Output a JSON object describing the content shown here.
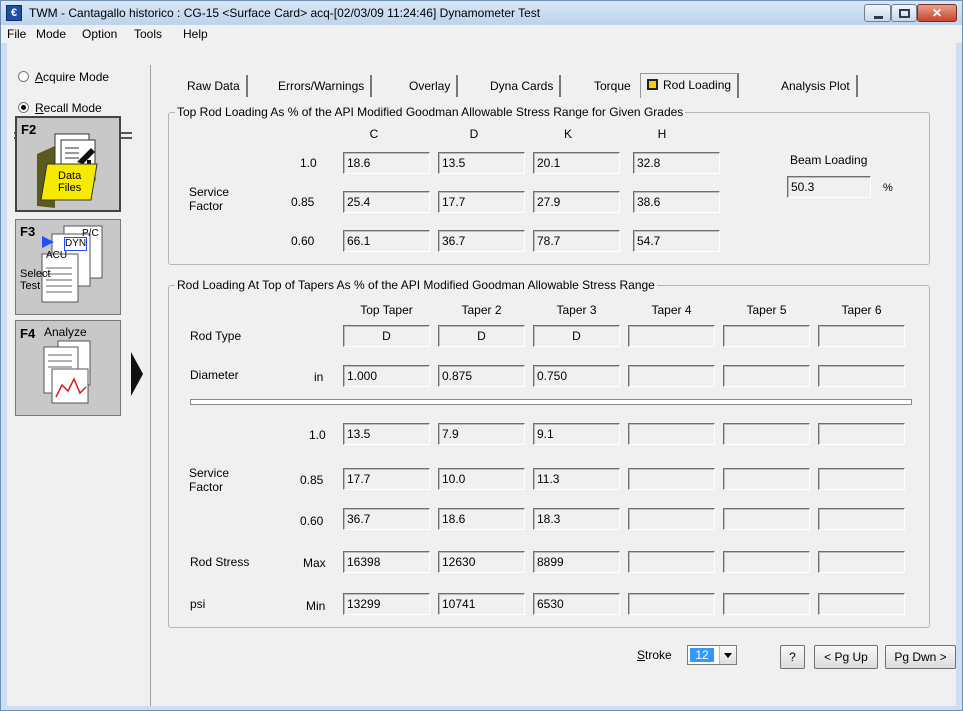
{
  "window": {
    "title": "TWM  -  Cantagallo historico : CG-15  <Surface Card>  acq-[02/03/09 11:24:46]  Dynamometer Test",
    "app_icon": "twm-app-icon",
    "close_glyph": "✕"
  },
  "menu": [
    "File",
    "Mode",
    "Option",
    "Tools",
    "Help"
  ],
  "sidebar": {
    "modes": [
      {
        "prefix": "",
        "accel": "A",
        "rest": "cquire Mode",
        "selected": false
      },
      {
        "prefix": "",
        "accel": "R",
        "rest": "ecall Mode",
        "selected": true
      }
    ],
    "buttons": [
      {
        "key": "F2",
        "label_line1": "Data",
        "label_line2": "Files"
      },
      {
        "key": "F3",
        "label_line1": "Select",
        "label_line2": "Test",
        "icon_tags": [
          "P/C",
          "DYN",
          "ACU"
        ]
      },
      {
        "key": "F4",
        "label_line1": "Analyze",
        "label_line2": ""
      }
    ]
  },
  "tabs": [
    "Raw Data",
    "Errors/Warnings",
    "Overlay",
    "Dyna Cards",
    "Torque",
    "Rod Loading",
    "Analysis Plot"
  ],
  "active_tab": "Rod Loading",
  "top_group": {
    "title": "Top Rod Loading As % of the API Modified Goodman Allowable Stress Range for Given Grades",
    "grades": [
      "C",
      "D",
      "K",
      "H"
    ],
    "service_factor_label_1": "Service",
    "service_factor_label_2": "Factor",
    "rows": [
      {
        "sf": "1.0",
        "values": [
          "18.6",
          "13.5",
          "20.1",
          "32.8"
        ]
      },
      {
        "sf": "0.85",
        "values": [
          "25.4",
          "17.7",
          "27.9",
          "38.6"
        ]
      },
      {
        "sf": "0.60",
        "values": [
          "66.1",
          "36.7",
          "78.7",
          "54.7"
        ]
      }
    ],
    "beam_loading_label": "Beam Loading",
    "beam_loading_value": "50.3",
    "beam_loading_unit": "%"
  },
  "taper_group": {
    "title": "Rod Loading At Top of Tapers As % of the API Modified Goodman Allowable Stress Range",
    "columns": [
      "Top Taper",
      "Taper 2",
      "Taper 3",
      "Taper 4",
      "Taper 5",
      "Taper 6"
    ],
    "rod_type_label": "Rod Type",
    "rod_types": [
      "D",
      "D",
      "D",
      "",
      "",
      ""
    ],
    "diameter_label": "Diameter",
    "diameter_unit": "in",
    "diameters": [
      "1.000",
      "0.875",
      "0.750",
      "",
      "",
      ""
    ],
    "service_factor_label_1": "Service",
    "service_factor_label_2": "Factor",
    "sf_rows": [
      {
        "sf": "1.0",
        "values": [
          "13.5",
          "7.9",
          "9.1",
          "",
          "",
          ""
        ]
      },
      {
        "sf": "0.85",
        "values": [
          "17.7",
          "10.0",
          "11.3",
          "",
          "",
          ""
        ]
      },
      {
        "sf": "0.60",
        "values": [
          "36.7",
          "18.6",
          "18.3",
          "",
          "",
          ""
        ]
      }
    ],
    "rod_stress_label": "Rod Stress",
    "psi_label": "psi",
    "max_label": "Max",
    "min_label": "Min",
    "max_values": [
      "16398",
      "12630",
      "8899",
      "",
      "",
      ""
    ],
    "min_values": [
      "13299",
      "10741",
      "6530",
      "",
      "",
      ""
    ]
  },
  "footer": {
    "stroke_accel": "S",
    "stroke_rest": "troke",
    "stroke_value": "12",
    "help_label": "?",
    "pgup_label": "< Pg Up",
    "pgdown_label": "Pg Dwn >"
  }
}
